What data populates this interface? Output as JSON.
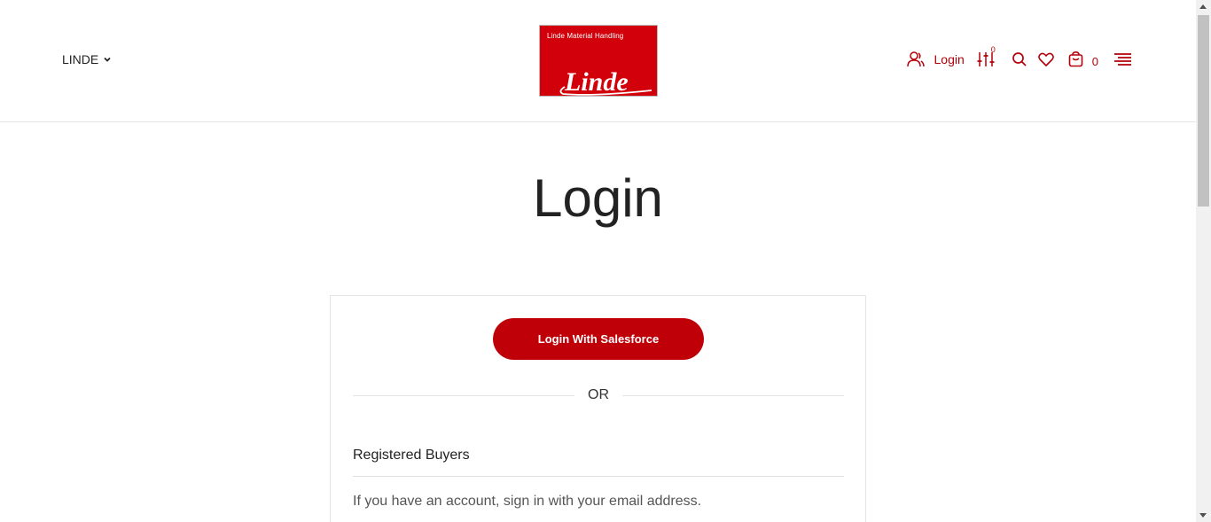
{
  "header": {
    "brand_selector": "LINDE",
    "logo_text": "Linde Material Handling",
    "logo_wordmark": "Linde",
    "login_label": "Login",
    "compare_count": "0",
    "cart_count": "0",
    "icons": [
      "chevron-down-icon",
      "user-icon",
      "compare-sliders-icon",
      "search-icon",
      "heart-icon",
      "cart-icon",
      "menu-icon"
    ]
  },
  "main": {
    "title": "Login",
    "salesforce_button": "Login With Salesforce",
    "or_text": "OR",
    "section_title": "Registered Buyers",
    "section_description": "If you have an account, sign in with your email address."
  },
  "colors": {
    "brand_red": "#c00009",
    "logo_red": "#d2000a"
  }
}
